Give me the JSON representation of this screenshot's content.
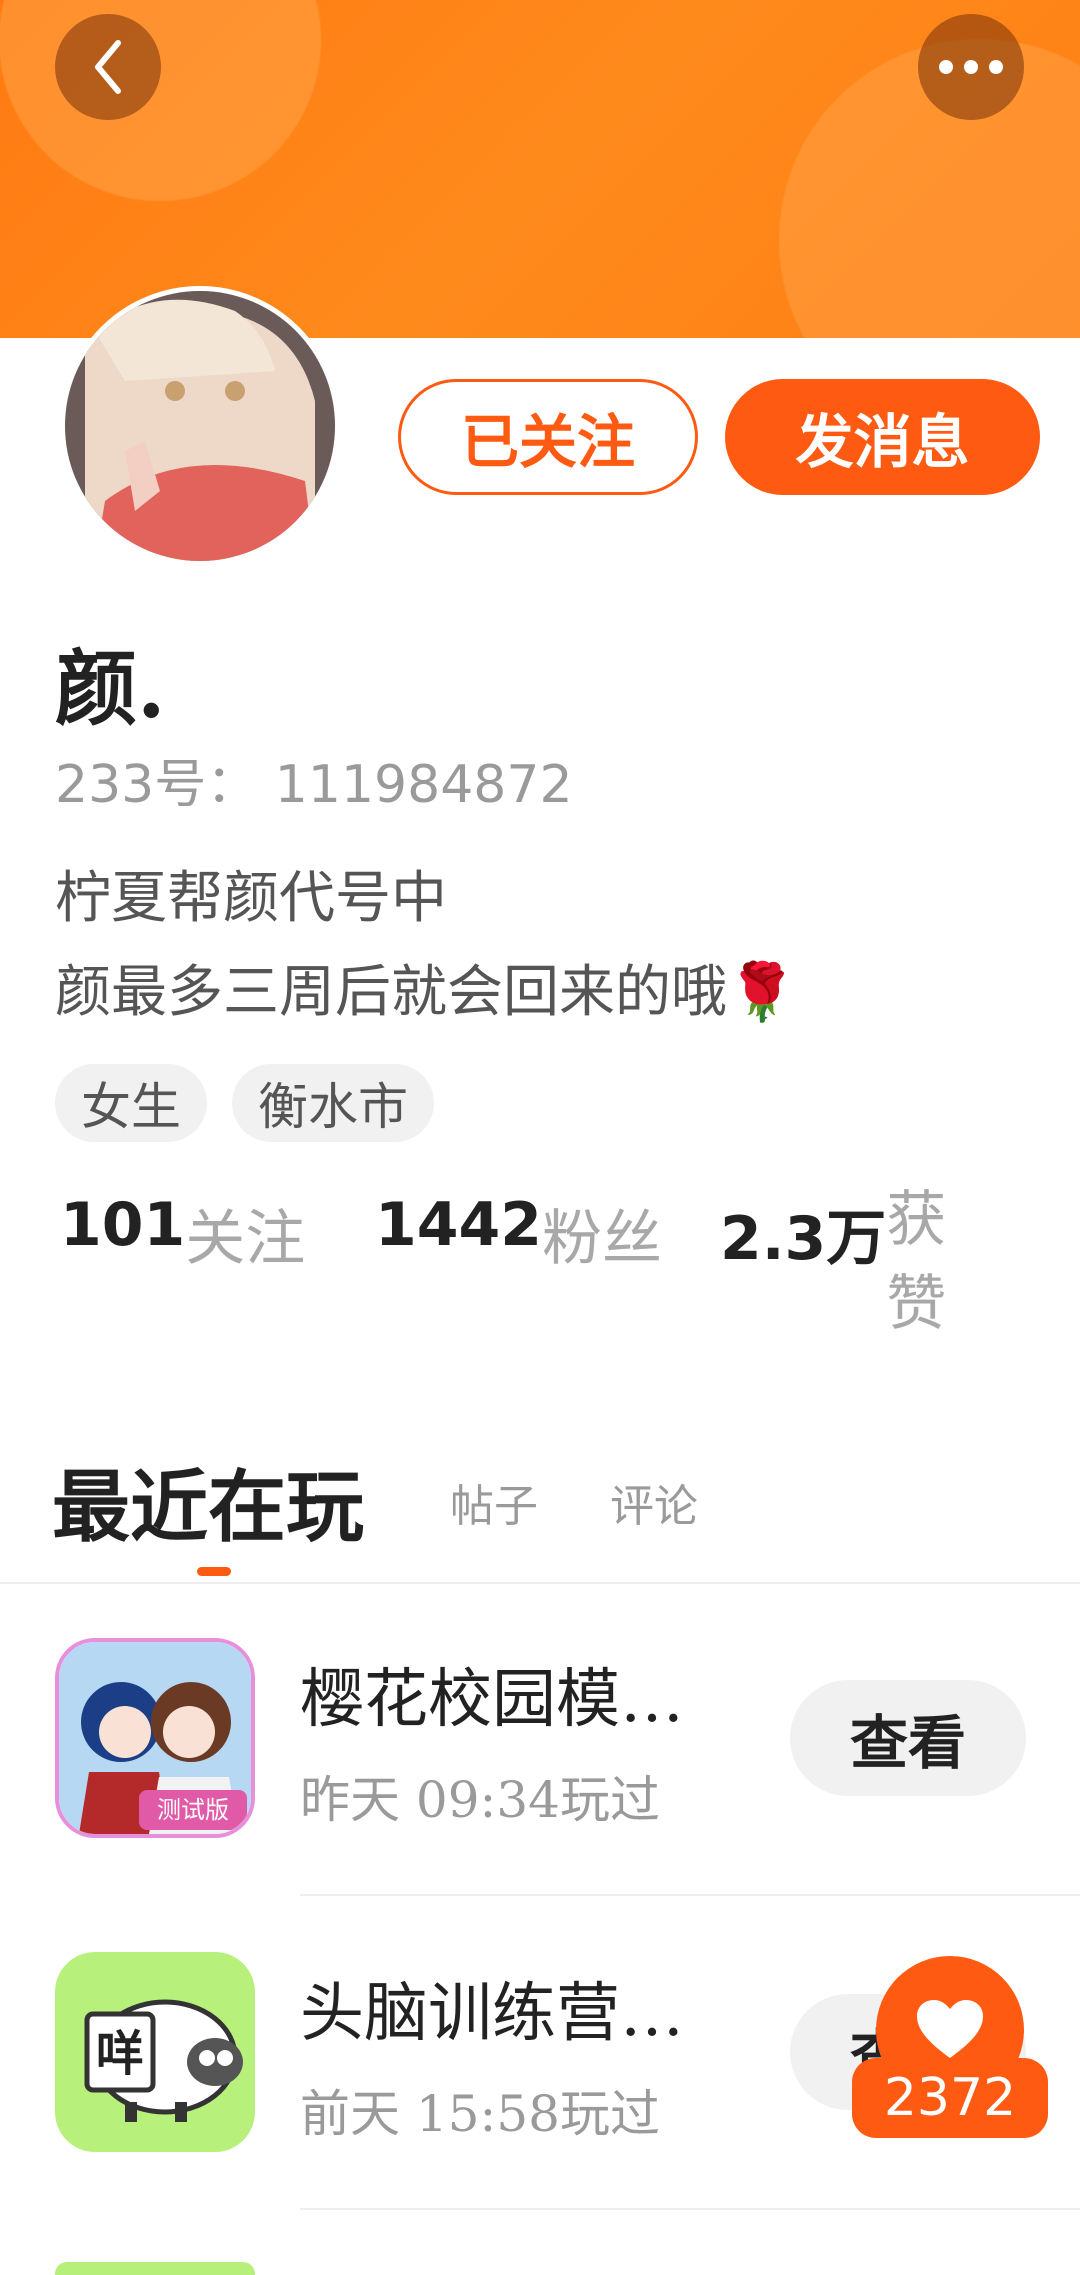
{
  "header": {
    "back_icon": "chevron-left-icon",
    "more_icon": "more-horizontal-icon"
  },
  "profile": {
    "follow_label": "已关注",
    "message_label": "发消息",
    "nickname": "颜.",
    "user_id": "233号： 111984872",
    "bio_lines": [
      "柠夏帮颜代号中",
      "颜最多三周后就会回来的哦🌹"
    ],
    "tags": [
      "女生",
      "衡水市"
    ],
    "stats": [
      {
        "value": "101",
        "label": "关注"
      },
      {
        "value": "1442",
        "label": "粉丝"
      },
      {
        "value": "2.3万",
        "label_line1": "获",
        "label_line2": "赞"
      }
    ]
  },
  "tabs": [
    {
      "label": "最近在玩",
      "active": true
    },
    {
      "label": "帖子",
      "active": false
    },
    {
      "label": "评论",
      "active": false
    }
  ],
  "games": [
    {
      "name": "樱花校园模…",
      "time": "昨天 09:34玩过",
      "action": "查看",
      "badge": "测试版"
    },
    {
      "name": "头脑训练营…",
      "time": "前天 15:58玩过",
      "action": "查看",
      "icon_text": "咩"
    }
  ],
  "like": {
    "count": "2372",
    "icon": "heart-icon"
  },
  "colors": {
    "accent": "#ff5a12",
    "banner": "#ff7f14"
  }
}
